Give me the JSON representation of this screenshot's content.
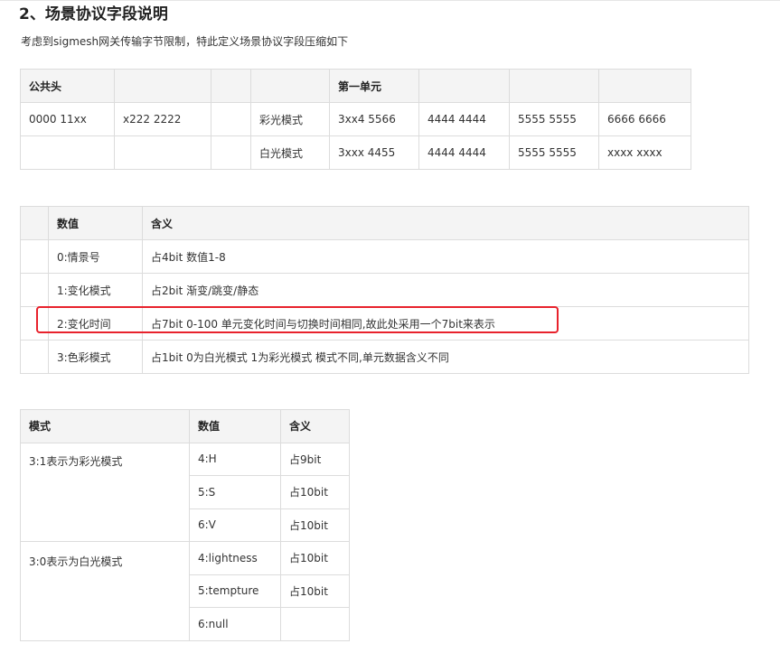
{
  "heading": "2、场景协议字段说明",
  "description": "考虑到sigmesh网关传输字节限制，特此定义场景协议字段压缩如下",
  "table1": {
    "header": [
      "公共头",
      "",
      "",
      "",
      "第一单元",
      "",
      "",
      ""
    ],
    "rows": [
      [
        "0000 11xx",
        "x222 2222",
        "",
        "彩光模式",
        "3xx4 5566",
        "4444 4444",
        "5555 5555",
        "6666 6666"
      ],
      [
        "",
        "",
        "",
        "白光模式",
        "3xxx 4455",
        "4444 4444",
        "5555 5555",
        "xxxx xxxx"
      ]
    ]
  },
  "table2": {
    "header": [
      "",
      "数值",
      "含义"
    ],
    "rows": [
      [
        "",
        "0:情景号",
        "占4bit 数值1-8"
      ],
      [
        "",
        "1:变化模式",
        "占2bit 渐变/跳变/静态"
      ],
      [
        "",
        "2:变化时间",
        "占7bit 0-100 单元变化时间与切换时间相同,故此处采用一个7bit来表示"
      ],
      [
        "",
        "3:色彩模式",
        "占1bit 0为白光模式 1为彩光模式 模式不同,单元数据含义不同"
      ]
    ],
    "highlighted_row": "2:变化时间",
    "highlight_color": "#e8222c"
  },
  "table3": {
    "header": [
      "模式",
      "数值",
      "含义"
    ],
    "groups": [
      {
        "mode": "3:1表示为彩光模式",
        "rows": [
          [
            "4:H",
            "占9bit"
          ],
          [
            "5:S",
            "占10bit"
          ],
          [
            "6:V",
            "占10bit"
          ]
        ]
      },
      {
        "mode": "3:0表示为白光模式",
        "rows": [
          [
            "4:lightness",
            "占10bit"
          ],
          [
            "5:tempture",
            "占10bit"
          ],
          [
            "6:null",
            ""
          ]
        ]
      }
    ]
  }
}
